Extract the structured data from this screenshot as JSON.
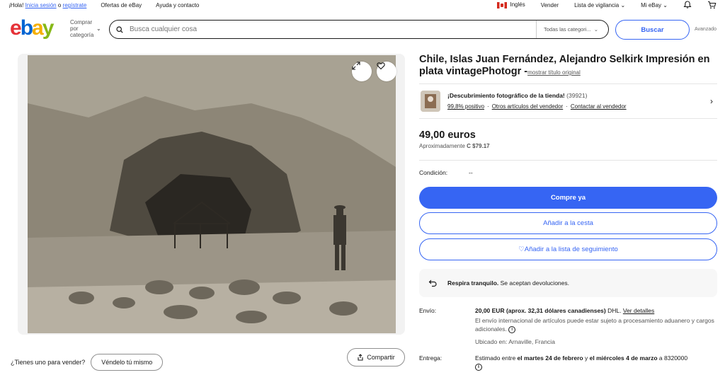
{
  "topbar": {
    "greeting": "¡Hola!",
    "signin": "Inicia sesión",
    "or": "o",
    "register": "regístrate",
    "deals": "Ofertas de eBay",
    "help": "Ayuda y contacto",
    "language": "Inglés",
    "sell": "Vender",
    "watchlist": "Lista de vigilancia",
    "myebay": "Mi eBay"
  },
  "header": {
    "logo": [
      "e",
      "b",
      "a",
      "y"
    ],
    "shop_by": "Comprar por categoría",
    "search_placeholder": "Busca cualquier cosa",
    "category": "Todas las categori...",
    "search_button": "Buscar",
    "advanced": "Avanzado"
  },
  "gallery": {
    "sell_prompt": "¿Tienes uno para vender?",
    "sell_button": "Véndelo tú mismo",
    "share_button": "Compartir"
  },
  "item": {
    "title": "Chile, Islas Juan Fernández, Alejandro Selkirk Impresión en plata vintagePhotogr -",
    "show_original": "mostrar título original",
    "seller_name": "¡Descubrimiento fotográfico de la tienda!",
    "seller_feedback": "(39921)",
    "seller_positive": "99,8% positivo",
    "seller_other": "Otros artículos del vendedor",
    "seller_contact": "Contactar al vendedor",
    "price": "49,00 euros",
    "approx_label": "Aproximadamente",
    "approx_value": "C $79.17",
    "condition_label": "Condición:",
    "condition_value": "--",
    "buy_now": "Compre ya",
    "add_cart": "Añadir a la cesta",
    "add_watch": "Añadir a la lista de seguimiento",
    "returns_bold": "Respira tranquilo.",
    "returns_text": "Se aceptan devoluciones.",
    "shipping_label": "Envío:",
    "shipping_value": "20,00 EUR (aprox. 32,31 dólares canadienses)",
    "shipping_carrier": "DHL.",
    "shipping_details": "Ver detalles",
    "shipping_note": "El envío internacional de artículos puede estar sujeto a procesamiento aduanero y cargos adicionales.",
    "location": "Ubicado en: Arnaville, Francia",
    "delivery_label": "Entrega:",
    "delivery_value_pre": "Estimado entre",
    "delivery_date1": "el martes 24 de febrero",
    "delivery_and": "y",
    "delivery_date2": "el miércoles 4 de marzo",
    "delivery_post": "a 8320000"
  }
}
